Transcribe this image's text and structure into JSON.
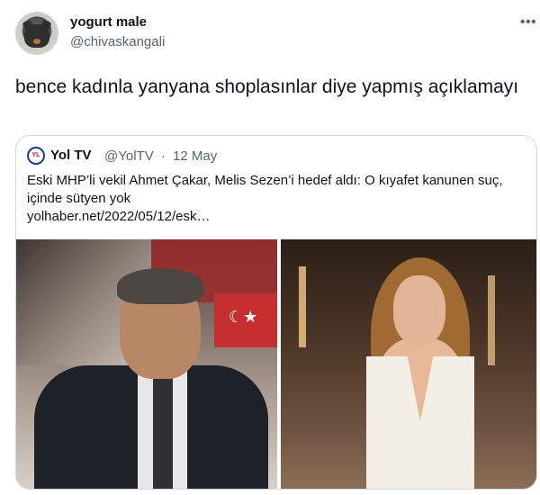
{
  "tweet": {
    "display_name": "yogurt male",
    "handle": "@chivaskangali",
    "text": "bence kadınla yanyana shoplasınlar diye yapmış açıklamayı",
    "more_icon": "more-horizontal-icon"
  },
  "quoted_tweet": {
    "avatar_text": "YL",
    "display_name": "Yol TV",
    "handle": "@YolTV",
    "separator": "·",
    "date": "12 May",
    "text_line1": "Eski MHP’li vekil Ahmet Çakar, Melis Sezen’i hedef aldı: O kıyafet kanunen suç,",
    "text_line2": "içinde sütyen yok",
    "link": "yolhaber.net/2022/05/12/esk…"
  }
}
